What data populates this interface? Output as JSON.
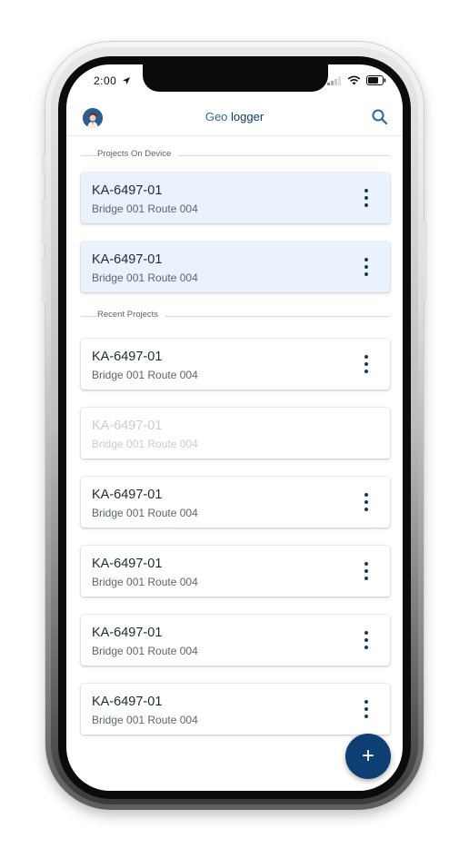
{
  "status_bar": {
    "time": "2:00"
  },
  "app_bar": {
    "title_part1": "Geo",
    "title_part2": "logger"
  },
  "sections": {
    "on_device": "Projects On Device",
    "recent": "Recent Projects"
  },
  "device_projects": [
    {
      "code": "KA-6497-01",
      "name": "Bridge 001 Route 004"
    },
    {
      "code": "KA-6497-01",
      "name": "Bridge 001 Route 004"
    }
  ],
  "recent_projects": [
    {
      "code": "KA-6497-01",
      "name": "Bridge 001 Route 004"
    },
    {
      "code": "KA-6497-01",
      "name": "Bridge 001 Route 004"
    },
    {
      "code": "KA-6497-01",
      "name": "Bridge 001 Route 004"
    },
    {
      "code": "KA-6497-01",
      "name": "Bridge 001 Route 004"
    },
    {
      "code": "KA-6497-01",
      "name": "Bridge 001 Route 004"
    },
    {
      "code": "KA-6497-01",
      "name": "Bridge 001 Route 004"
    }
  ],
  "fab": {
    "label": "+"
  },
  "icons": {
    "location": "location-arrow-icon",
    "signal": "signal-icon",
    "wifi": "wifi-icon",
    "battery": "battery-icon",
    "search": "search-icon",
    "more": "more-vertical-icon",
    "add": "add-icon"
  },
  "colors": {
    "accent": "#0e3f73",
    "local_card_bg": "#eaf2fd",
    "title_blue": "#2b6aa0"
  }
}
